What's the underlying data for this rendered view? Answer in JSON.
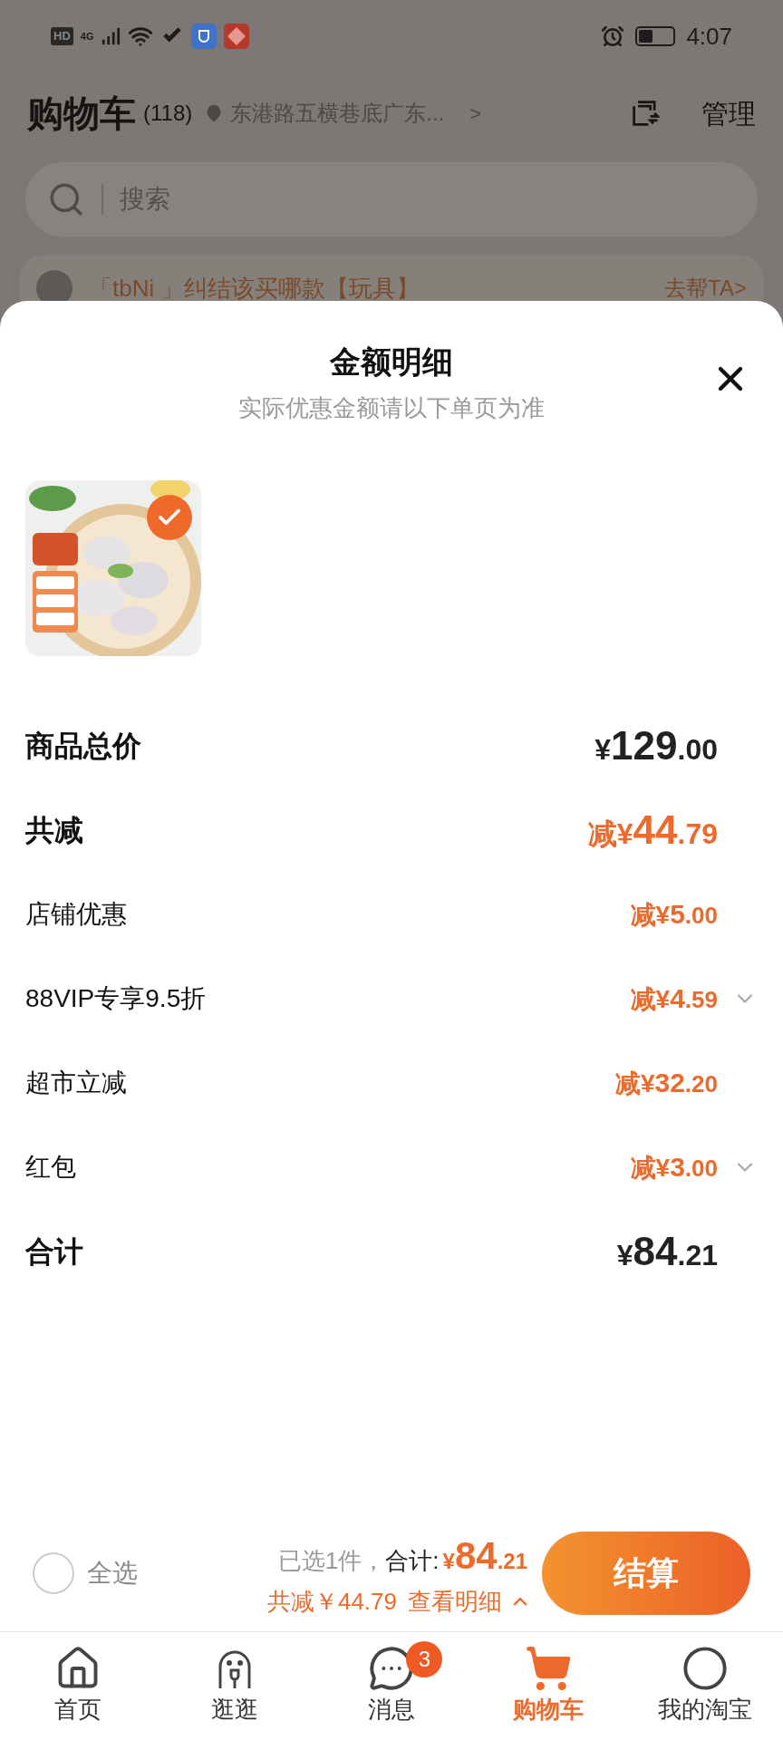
{
  "status_bar": {
    "hd": "HD",
    "network": "4G",
    "time": "4:07"
  },
  "header": {
    "title": "购物车",
    "count": "(118)",
    "address": "东港路五横巷底广东...",
    "chevron": ">",
    "manage": "管理"
  },
  "search": {
    "placeholder": "搜索"
  },
  "banner": {
    "text": "「tbNi 」纠结该买哪款【玩具】",
    "action": "去帮TA>"
  },
  "sheet": {
    "title": "金额明细",
    "subtitle": "实际优惠金额请以下单页为准",
    "product": {
      "kind": "picture",
      "checked": true
    },
    "rows": [
      {
        "kind": "total",
        "label": "商品总价",
        "prefix": "",
        "currency": "¥",
        "integer": "129",
        "decimal": ".00",
        "expandable": false
      },
      {
        "kind": "discount_total",
        "label": "共减",
        "prefix": "减",
        "currency": "¥",
        "integer": "44",
        "decimal": ".79",
        "expandable": false
      },
      {
        "kind": "discount",
        "label": "店铺优惠",
        "prefix": "减",
        "currency": "¥",
        "integer": "5",
        "decimal": ".00",
        "expandable": false
      },
      {
        "kind": "discount",
        "label": "88VIP专享9.5折",
        "prefix": "减",
        "currency": "¥",
        "integer": "4",
        "decimal": ".59",
        "expandable": true
      },
      {
        "kind": "discount",
        "label": "超市立减",
        "prefix": "减",
        "currency": "¥",
        "integer": "32",
        "decimal": ".20",
        "expandable": false
      },
      {
        "kind": "discount",
        "label": "红包",
        "prefix": "减",
        "currency": "¥",
        "integer": "3",
        "decimal": ".00",
        "expandable": true
      },
      {
        "kind": "total",
        "label": "合计",
        "prefix": "",
        "currency": "¥",
        "integer": "84",
        "decimal": ".21",
        "expandable": false
      }
    ]
  },
  "checkout": {
    "select_all": {
      "label": "全选",
      "checked": false
    },
    "selected_count": "已选1件，",
    "total_label": "合计:",
    "currency": "¥",
    "integer": "84",
    "decimal": ".21",
    "saving": "共减￥44.79",
    "details": "查看明细",
    "submit": "结算"
  },
  "tab_bar": [
    {
      "kind": "home",
      "label": "首页",
      "selected": false
    },
    {
      "kind": "stroll",
      "label": "逛逛",
      "selected": false
    },
    {
      "kind": "messages",
      "label": "消息",
      "selected": false,
      "badge": "3"
    },
    {
      "kind": "cart",
      "label": "购物车",
      "selected": true
    },
    {
      "kind": "profile",
      "label": "我的淘宝",
      "selected": false
    }
  ]
}
